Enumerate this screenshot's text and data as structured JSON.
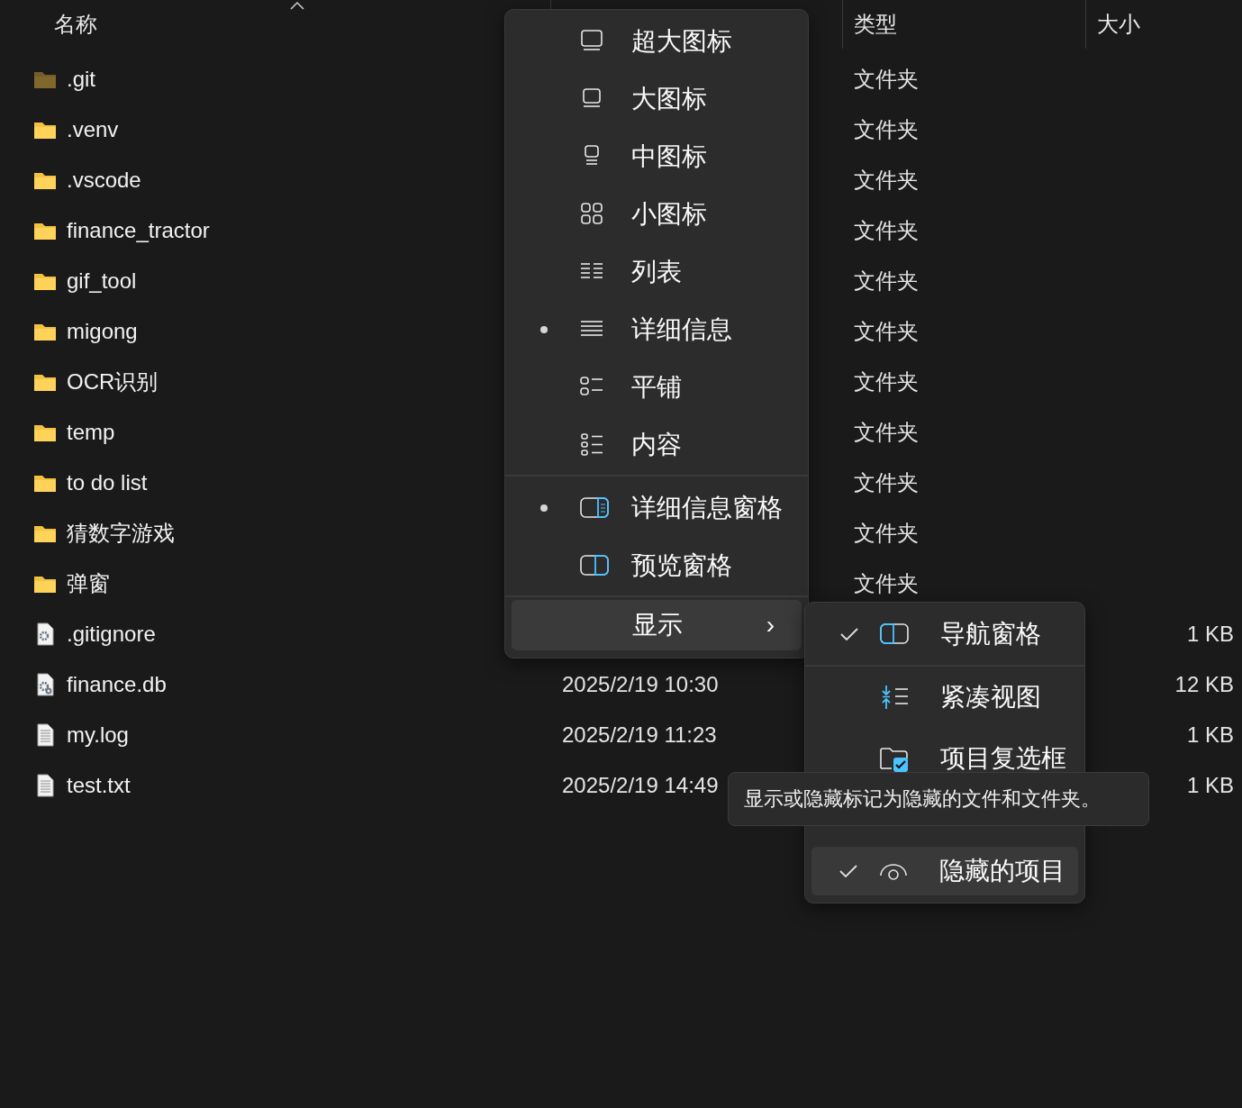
{
  "table": {
    "columns": [
      {
        "label": "名称",
        "sorted": true
      },
      {
        "label": "类型",
        "sorted": false
      },
      {
        "label": "大小",
        "sorted": false
      }
    ],
    "rows": [
      {
        "name": ".git",
        "kind": "folder",
        "hidden": true,
        "type": "文件夹"
      },
      {
        "name": ".venv",
        "kind": "folder",
        "hidden": false,
        "type": "文件夹"
      },
      {
        "name": ".vscode",
        "kind": "folder",
        "hidden": false,
        "type": "文件夹"
      },
      {
        "name": "finance_tractor",
        "kind": "folder",
        "hidden": false,
        "type": "文件夹"
      },
      {
        "name": "gif_tool",
        "kind": "folder",
        "hidden": false,
        "type": "文件夹"
      },
      {
        "name": "migong",
        "kind": "folder",
        "hidden": false,
        "type": "文件夹"
      },
      {
        "name": "OCR识别",
        "kind": "folder",
        "hidden": false,
        "type": "文件夹"
      },
      {
        "name": "temp",
        "kind": "folder",
        "hidden": false,
        "type": "文件夹"
      },
      {
        "name": "to do list",
        "kind": "folder",
        "hidden": false,
        "type": "文件夹"
      },
      {
        "name": "猜数字游戏",
        "kind": "folder",
        "hidden": false,
        "type": "文件夹"
      },
      {
        "name": "弹窗",
        "kind": "folder",
        "hidden": false,
        "type": "文件夹"
      },
      {
        "name": ".gitignore",
        "kind": "config",
        "hidden": false,
        "size": "1 KB"
      },
      {
        "name": "finance.db",
        "kind": "database",
        "hidden": false,
        "date": "2025/2/19 10:30",
        "size": "12 KB"
      },
      {
        "name": "my.log",
        "kind": "text",
        "hidden": false,
        "date": "2025/2/19 11:23",
        "size": "1 KB"
      },
      {
        "name": "test.txt",
        "kind": "text",
        "hidden": false,
        "date": "2025/2/19 14:49",
        "size": "1 KB"
      }
    ]
  },
  "view_menu": {
    "layout_items": [
      {
        "label": "超大图标",
        "selected": false
      },
      {
        "label": "大图标",
        "selected": false
      },
      {
        "label": "中图标",
        "selected": false
      },
      {
        "label": "小图标",
        "selected": false
      },
      {
        "label": "列表",
        "selected": false
      },
      {
        "label": "详细信息",
        "selected": true
      },
      {
        "label": "平铺",
        "selected": false
      },
      {
        "label": "内容",
        "selected": false
      }
    ],
    "pane_items": [
      {
        "label": "详细信息窗格",
        "selected": true
      },
      {
        "label": "预览窗格",
        "selected": false
      }
    ],
    "show_button": {
      "label": "显示",
      "chevron": "›"
    }
  },
  "show_submenu": {
    "items": [
      {
        "label": "导航窗格",
        "checked": true,
        "hovered": false
      },
      {
        "label": "紧凑视图",
        "checked": false,
        "hovered": false
      },
      {
        "label": "项目复选框",
        "checked": false,
        "hovered": false
      },
      {
        "label": "隐藏的项目",
        "checked": true,
        "hovered": true
      }
    ]
  },
  "tooltip": {
    "text": "显示或隐藏标记为隐藏的文件和文件夹。"
  }
}
